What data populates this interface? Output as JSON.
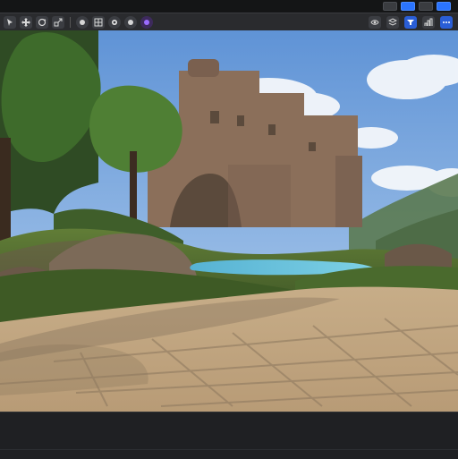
{
  "window": {
    "title": "",
    "top_right_controls": [
      {
        "icon": "display-icon"
      },
      {
        "icon": "play-icon"
      },
      {
        "icon": "settings-icon"
      },
      {
        "icon": "camera-icon"
      }
    ]
  },
  "toolbar": {
    "left_tools": [
      {
        "icon": "select-icon"
      },
      {
        "icon": "move-icon"
      },
      {
        "icon": "rotate-icon"
      },
      {
        "icon": "scale-icon"
      },
      {
        "icon": "snap-icon"
      },
      {
        "icon": "grid-icon"
      },
      {
        "icon": "lit-mode-icon"
      },
      {
        "icon": "camera-speed-icon"
      },
      {
        "icon": "purple-mode-icon"
      }
    ],
    "right_tools": [
      {
        "icon": "eye-icon"
      },
      {
        "icon": "layers-icon"
      },
      {
        "icon": "filter-icon"
      },
      {
        "icon": "stats-icon"
      },
      {
        "icon": "options-icon"
      }
    ]
  },
  "viewport": {
    "scene": "castle-landscape",
    "colors": {
      "sky_top": "#5f93d6",
      "sky_bottom": "#b8d3ef",
      "cloud": "#f4f7fb",
      "castle": "#8b6f5a",
      "castle_shadow": "#6c5646",
      "grass": "#4d6a2e",
      "water": "#5fb7d6",
      "pavement": "#c9b18f",
      "pavement_shadow": "#7b6a55"
    }
  },
  "bottom_panel": {
    "content": ""
  }
}
